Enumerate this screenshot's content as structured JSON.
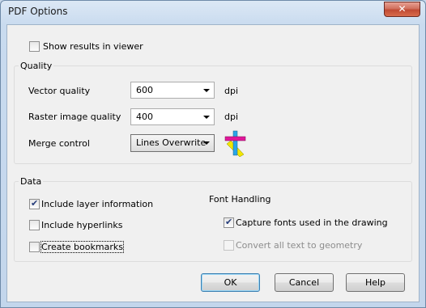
{
  "window": {
    "title": "PDF Options",
    "close_label": "✕"
  },
  "show_results": {
    "label": "Show results in viewer",
    "checked": false
  },
  "quality": {
    "title": "Quality",
    "vector_label": "Vector quality",
    "vector_value": "600",
    "vector_unit": "dpi",
    "raster_label": "Raster image quality",
    "raster_value": "400",
    "raster_unit": "dpi",
    "merge_label": "Merge control",
    "merge_value": "Lines Overwrite",
    "merge_icon": "lines-overwrite-icon"
  },
  "data": {
    "title": "Data",
    "include_layer": {
      "label": "Include layer information",
      "checked": true
    },
    "include_hyperlinks": {
      "label": "Include hyperlinks",
      "checked": false
    },
    "create_bookmarks": {
      "label": "Create bookmarks",
      "checked": false
    },
    "font_handling": {
      "title": "Font Handling",
      "capture_fonts": {
        "label": "Capture fonts used in the drawing",
        "checked": true
      },
      "convert_text": {
        "label": "Convert all text to geometry",
        "checked": false,
        "disabled": true
      }
    }
  },
  "buttons": {
    "ok": "OK",
    "cancel": "Cancel",
    "help": "Help"
  },
  "colors": {
    "icon_magenta": "#e0189a",
    "icon_cyan": "#2aa6e8",
    "icon_yellow": "#f2e600"
  }
}
